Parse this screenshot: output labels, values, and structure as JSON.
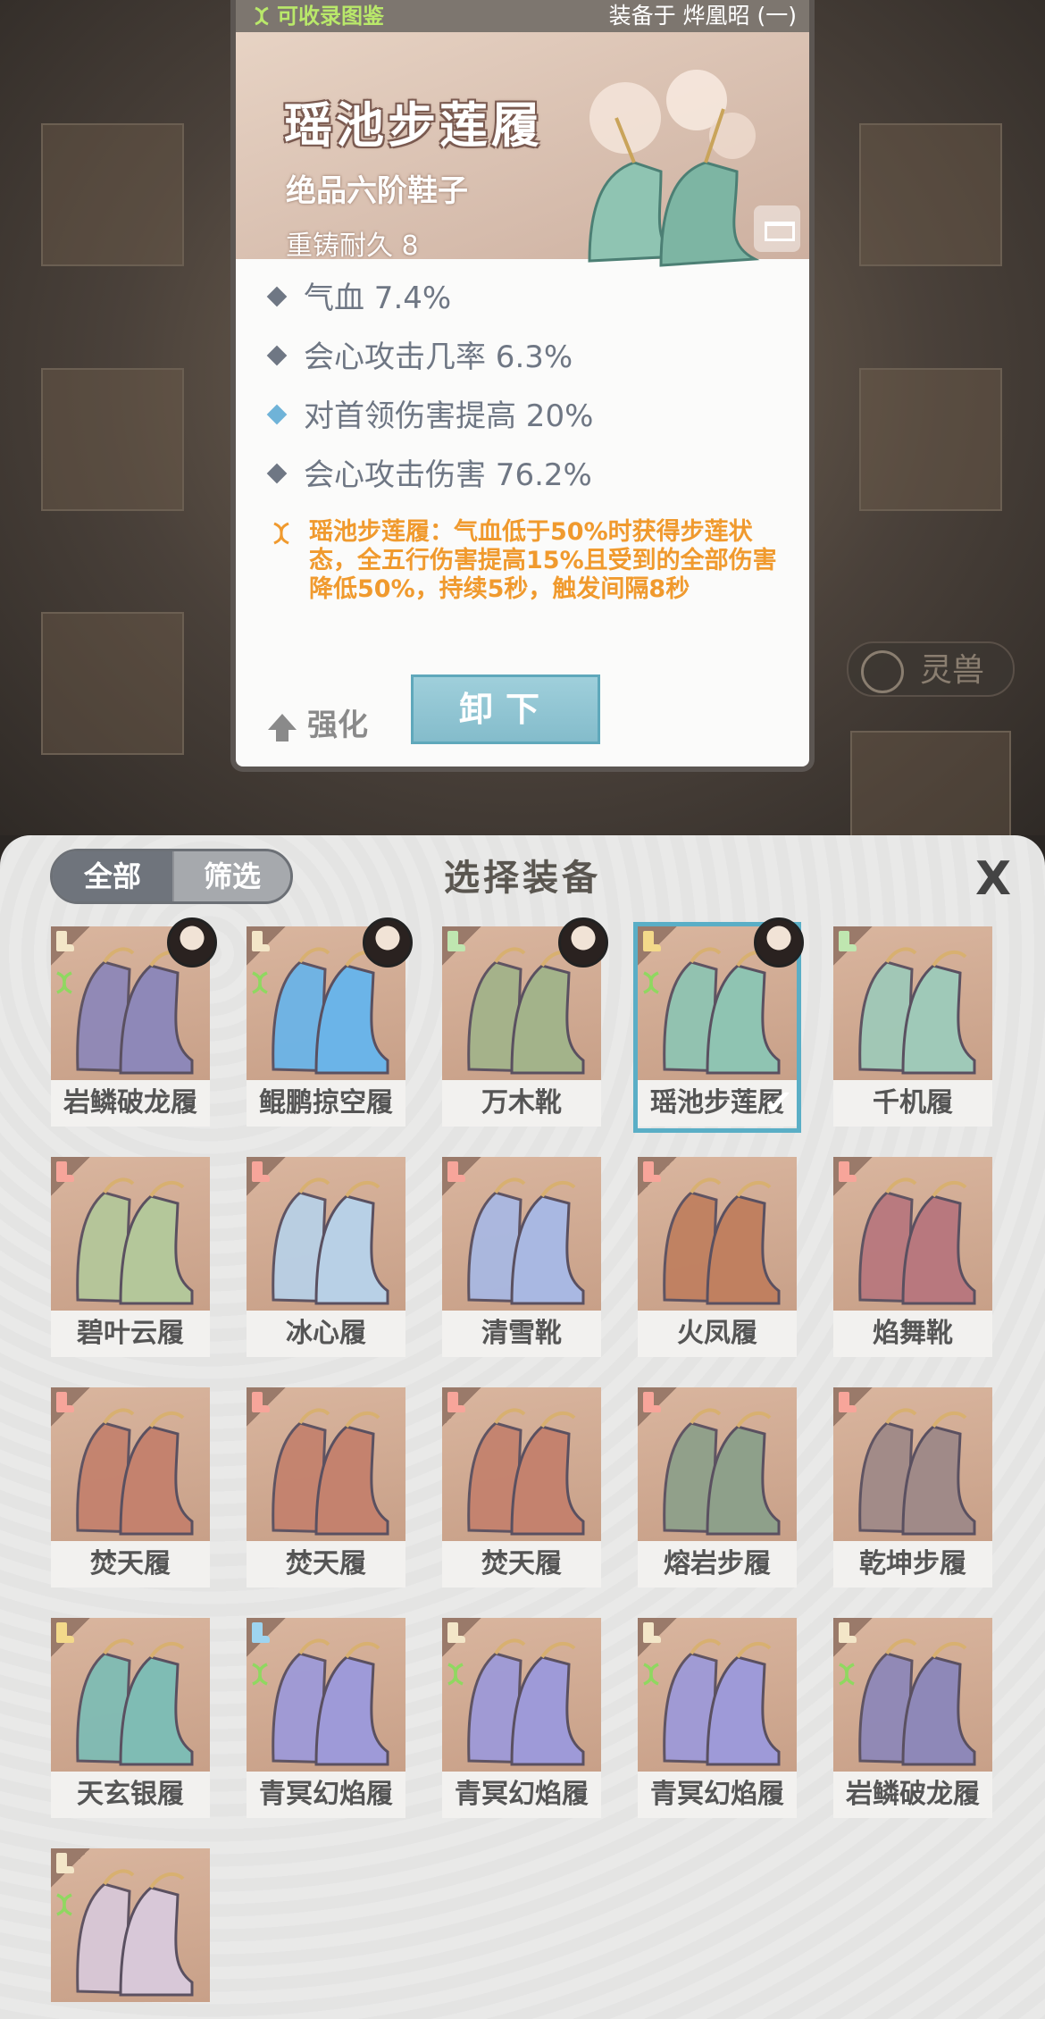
{
  "card": {
    "collectible_label": "可收录图鉴",
    "equipped_label": "装备于 烨凰昭 (一)",
    "name": "瑶池步莲履",
    "grade": "绝品六阶鞋子",
    "durability": "重铸耐久 8",
    "stats": [
      "气血 7.4%",
      "会心攻击几率 6.3%",
      "对首领伤害提高 20%",
      "会心攻击伤害 76.2%"
    ],
    "effect": "瑶池步莲履：气血低于50%时获得步莲状态，全五行伤害提高15%且受到的全部伤害降低50%，持续5秒，触发间隔8秒",
    "enhance_label": "强化",
    "unequip_label": "卸下",
    "colors": {
      "effect": "#f09a2e",
      "stat": "#6f7784",
      "accent": "#5aaec6",
      "collect": "#b9e86a"
    }
  },
  "background": {
    "spirit_label": "灵兽"
  },
  "panel": {
    "tab_all": "全部",
    "tab_filter": "筛选",
    "title": "选择装备",
    "close_label": "X",
    "selected_check": "✔",
    "items": [
      {
        "name": "岩鳞破龙履",
        "grade_color": "#f3e6c8",
        "collectible": true,
        "owner": true,
        "palette": "#8e88b8"
      },
      {
        "name": "鲲鹏掠空履",
        "grade_color": "#f3e6c8",
        "collectible": true,
        "owner": true,
        "palette": "#6bb4e8"
      },
      {
        "name": "万木靴",
        "grade_color": "#bfe6b0",
        "collectible": false,
        "owner": true,
        "palette": "#a3b38a"
      },
      {
        "name": "瑶池步莲履",
        "grade_color": "#f3d98a",
        "collectible": true,
        "owner": true,
        "selected": true,
        "palette": "#8fc4b2"
      },
      {
        "name": "千机履",
        "grade_color": "#bfe6b0",
        "collectible": false,
        "owner": false,
        "palette": "#9fc9b8"
      },
      {
        "name": "碧叶云履",
        "grade_color": "#f7a59a",
        "collectible": false,
        "owner": false,
        "palette": "#b4c79a"
      },
      {
        "name": "冰心履",
        "grade_color": "#f7a59a",
        "collectible": false,
        "owner": false,
        "palette": "#b8d0e6"
      },
      {
        "name": "清雪靴",
        "grade_color": "#f7a59a",
        "collectible": false,
        "owner": false,
        "palette": "#a9b8e2"
      },
      {
        "name": "火凤履",
        "grade_color": "#f7a59a",
        "collectible": false,
        "owner": false,
        "palette": "#c08060"
      },
      {
        "name": "焰舞靴",
        "grade_color": "#f7a59a",
        "collectible": false,
        "owner": false,
        "palette": "#b8787e"
      },
      {
        "name": "焚天履",
        "grade_color": "#f7a59a",
        "collectible": false,
        "owner": false,
        "palette": "#c4826e"
      },
      {
        "name": "焚天履",
        "grade_color": "#f7a59a",
        "collectible": false,
        "owner": false,
        "palette": "#c4826e"
      },
      {
        "name": "焚天履",
        "grade_color": "#f7a59a",
        "collectible": false,
        "owner": false,
        "palette": "#c4826e"
      },
      {
        "name": "熔岩步履",
        "grade_color": "#f7a59a",
        "collectible": false,
        "owner": false,
        "palette": "#8ea08a"
      },
      {
        "name": "乾坤步履",
        "grade_color": "#f7a59a",
        "collectible": false,
        "owner": false,
        "palette": "#a08a88"
      },
      {
        "name": "天玄银履",
        "grade_color": "#f3d98a",
        "collectible": false,
        "owner": false,
        "palette": "#7fbcb4"
      },
      {
        "name": "青冥幻焰履",
        "grade_color": "#9ed4f0",
        "collectible": true,
        "owner": false,
        "palette": "#9e9ad8"
      },
      {
        "name": "青冥幻焰履",
        "grade_color": "#f3e6c8",
        "collectible": true,
        "owner": false,
        "palette": "#9e9ad8"
      },
      {
        "name": "青冥幻焰履",
        "grade_color": "#f3e6c8",
        "collectible": true,
        "owner": false,
        "palette": "#9e9ad8"
      },
      {
        "name": "岩鳞破龙履",
        "grade_color": "#f3e6c8",
        "collectible": true,
        "owner": false,
        "palette": "#8e88b8"
      },
      {
        "name": "",
        "grade_color": "#f3e6c8",
        "collectible": true,
        "owner": false,
        "palette": "#d8c8d8"
      }
    ]
  }
}
